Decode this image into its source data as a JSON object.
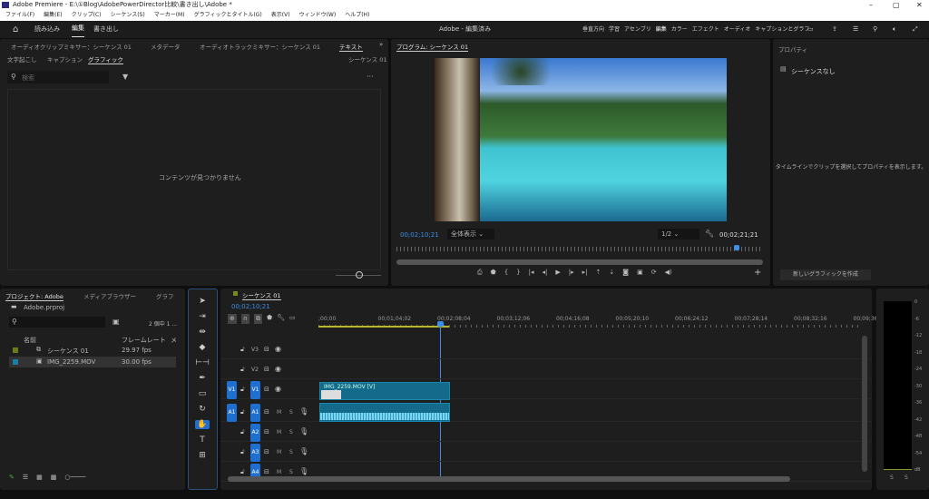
{
  "window": {
    "title": "Adobe Premiere - E:\\①Blog\\AdobePowerDirector比較\\書き出し\\Adobe *",
    "minimize": "–",
    "maximize": "▢",
    "close": "✕"
  },
  "menu": [
    "ファイル(F)",
    "編集(E)",
    "クリップ(C)",
    "シーケンス(S)",
    "マーカー(M)",
    "グラフィックとタイトル(G)",
    "表示(V)",
    "ウィンドウ(W)",
    "ヘルプ(H)"
  ],
  "appbar": {
    "modes": [
      "読み込み",
      "編集",
      "書き出し"
    ],
    "active_mode": "編集",
    "project_title": "Adobe - 編集済み",
    "workspaces": [
      "垂直方向",
      "学習",
      "アセンブリ",
      "編集",
      "カラー",
      "エフェクト",
      "オーディオ",
      "キャプションとグラフ"
    ]
  },
  "left_panel": {
    "tabs": [
      "オーディオクリップミキサー：シーケンス 01",
      "メタデータ",
      "オーディオトラックミキサー：シーケンス 01",
      "テキスト"
    ],
    "subtabs": [
      "文字起こし",
      "キャプション",
      "グラフィック"
    ],
    "sequence_label": "シーケンス 01",
    "search_placeholder": "検索",
    "empty_message": "コンテンツが見つかりません"
  },
  "program": {
    "title": "プログラム: シーケンス 01",
    "current_time": "00;02;10;21",
    "zoom": "全体表示",
    "resolution": "1/2",
    "duration": "00;02;21;21",
    "playhead_fraction": 0.92
  },
  "properties": {
    "title": "プロパティ",
    "selection": "シーケンスなし",
    "hint": "タイムラインでクリップを選択してプロパティを表示します。",
    "new_graphic": "新しいグラフィックを作成"
  },
  "project": {
    "tabs": [
      "プロジェクト: Adobe",
      "メディアブラウザー",
      "グラフ"
    ],
    "file": "Adobe.prproj",
    "count": "2 個中 1 ...",
    "columns": [
      "名前",
      "フレームレート",
      "メ"
    ],
    "items": [
      {
        "name": "シーケンス 01",
        "fps": "29.97 fps",
        "color": "#6b7a1a"
      },
      {
        "name": "IMG_2259.MOV",
        "fps": "30.00 fps",
        "color": "#1a7fa8"
      }
    ]
  },
  "timeline": {
    "title": "シーケンス 01",
    "current_time": "00;02;10;21",
    "ruler": [
      ";00;00",
      "00;01;04;02",
      "00;02;08;04",
      "00;03;12;06",
      "00;04;16;08",
      "00;05;20;10",
      "00;06;24;12",
      "00;07;28;14",
      "00;08;32;16",
      "00;09;36"
    ],
    "video_tracks": [
      "V3",
      "V2",
      "V1"
    ],
    "audio_tracks": [
      "A1",
      "A2",
      "A3",
      "A4"
    ],
    "clip_label": "IMG_2259.MOV [V]",
    "mute": "M",
    "solo": "S"
  },
  "meter": {
    "scale": [
      "0",
      "-6",
      "-12",
      "-18",
      "-24",
      "-30",
      "-36",
      "-42",
      "-48",
      "-54",
      "dB"
    ],
    "channels": [
      "S",
      "S"
    ]
  }
}
